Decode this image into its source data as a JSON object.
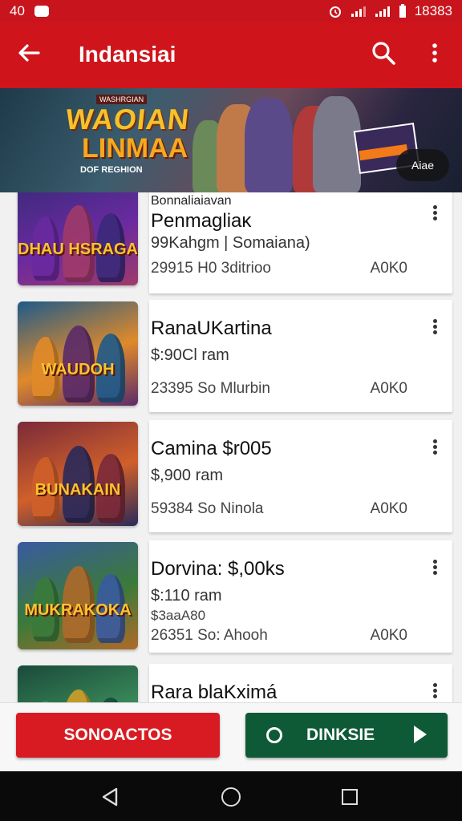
{
  "status_bar": {
    "left_text": "40",
    "time": "18383"
  },
  "app_bar": {
    "title": "Indansiai"
  },
  "banner": {
    "tag": "WASHRGIAN",
    "title_line1": "WAOIAN",
    "title_line2": "LINMAA",
    "subtitle": "DOF REGHION",
    "chip_label": "Aiae"
  },
  "items": [
    {
      "line0": "Bonnaliaiavan",
      "title": "Penmagliaĸ",
      "sub": "99Kahgm | Somaiana)",
      "meta": "29915 H0 3ditrioo",
      "price": "A0K0",
      "thumb_text": "DHAU\nHSRAGA",
      "thumb_colors": [
        "#3a2a7a",
        "#6a2aa0",
        "#a03a6a"
      ]
    },
    {
      "line0": "",
      "title": "RanaUKartina",
      "sub": "$:90Cl ram",
      "meta": "23395 So Mlurbin",
      "price": "A0K0",
      "thumb_text": "WAUDOH",
      "thumb_colors": [
        "#1e5a8a",
        "#e08a2a",
        "#5a2a6a"
      ]
    },
    {
      "line0": "",
      "title": "Camina $r005",
      "sub": "$,900 ram",
      "meta": "59384 So Ninola",
      "price": "A0K0",
      "thumb_text": "BUNAKAIN",
      "thumb_colors": [
        "#7a2a3a",
        "#d0602a",
        "#2a2a5a"
      ]
    },
    {
      "line0": "",
      "title": "Dorvina: $,00ks",
      "sub": "$:110 ram",
      "sub2": "$3aaA80",
      "meta": "26351 So: Ahooh",
      "price": "A0K0",
      "thumb_text": "MUKRAKOKA",
      "thumb_colors": [
        "#3a5aa0",
        "#3a7a3a",
        "#b06a2a"
      ]
    },
    {
      "line0": "",
      "title": "Rara blaKximá",
      "sub": "",
      "meta": "",
      "price": "",
      "thumb_text": "",
      "thumb_colors": [
        "#1a4a3a",
        "#3a8a5a",
        "#d0a02a"
      ]
    }
  ],
  "bottom_actions": {
    "primary_label": "SONOACTOS",
    "secondary_label": "DINKSIE"
  }
}
